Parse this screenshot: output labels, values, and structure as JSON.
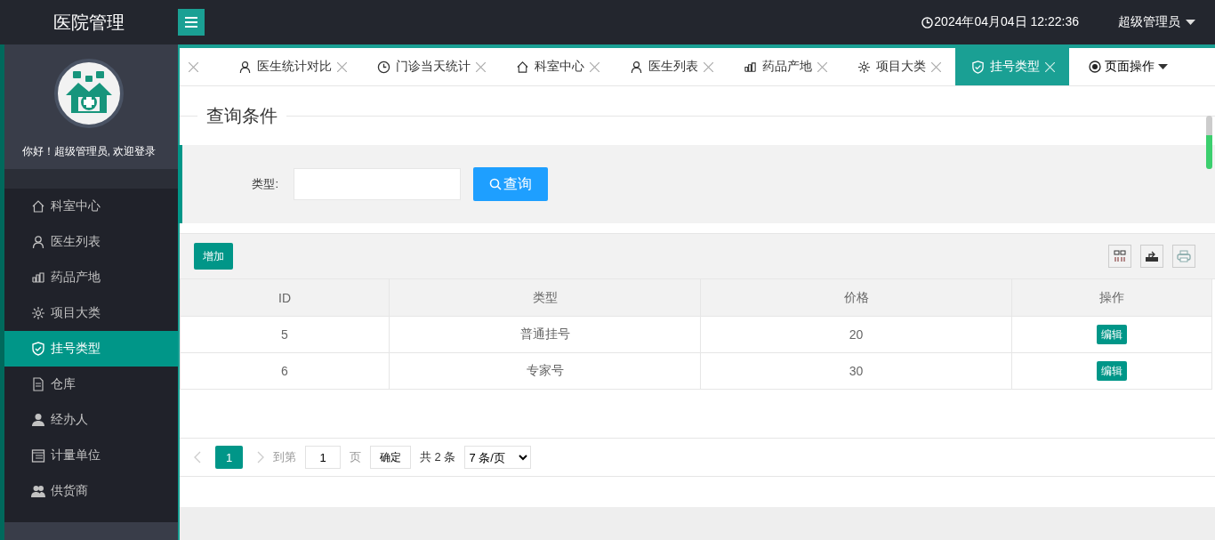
{
  "header": {
    "title": "医院管理",
    "datetime": "2024年04月04日 12:22:36",
    "user": "超级管理员"
  },
  "sidebar": {
    "greeting": "你好！超级管理员, 欢迎登录",
    "items": [
      {
        "label": "科室中心",
        "kind": "home",
        "selected": false
      },
      {
        "label": "医生列表",
        "kind": "user",
        "selected": false
      },
      {
        "label": "药品产地",
        "kind": "chart",
        "selected": false
      },
      {
        "label": "项目大类",
        "kind": "gear",
        "selected": false
      },
      {
        "label": "挂号类型",
        "kind": "shield",
        "selected": true
      },
      {
        "label": "仓库",
        "kind": "file",
        "selected": false
      },
      {
        "label": "经办人",
        "kind": "person",
        "selected": false
      },
      {
        "label": "计量单位",
        "kind": "calendar",
        "selected": false
      },
      {
        "label": "供货商",
        "kind": "people",
        "selected": false
      }
    ]
  },
  "tabs": [
    {
      "label": "医生统计对比",
      "kind": "user",
      "selected": false
    },
    {
      "label": "门诊当天统计",
      "kind": "clock",
      "selected": false
    },
    {
      "label": "科室中心",
      "kind": "home",
      "selected": false
    },
    {
      "label": "医生列表",
      "kind": "user",
      "selected": false
    },
    {
      "label": "药品产地",
      "kind": "chart",
      "selected": false
    },
    {
      "label": "项目大类",
      "kind": "gear",
      "selected": false
    },
    {
      "label": "挂号类型",
      "kind": "shield",
      "selected": true
    }
  ],
  "page_actions": "页面操作",
  "query": {
    "legend": "查询条件",
    "field_label": "类型:",
    "button": "查询"
  },
  "toolbar": {
    "add_button": "增加"
  },
  "table": {
    "columns": [
      "ID",
      "类型",
      "价格",
      "操作"
    ],
    "rows": [
      {
        "id": "5",
        "type": "普通挂号",
        "price": "20",
        "action": "编辑"
      },
      {
        "id": "6",
        "type": "专家号",
        "price": "30",
        "action": "编辑"
      }
    ]
  },
  "pagination": {
    "current": "1",
    "goto_label": "到第",
    "goto_value": "1",
    "page_unit": "页",
    "confirm": "确定",
    "total": "共 2 条",
    "page_size": "7 条/页"
  }
}
